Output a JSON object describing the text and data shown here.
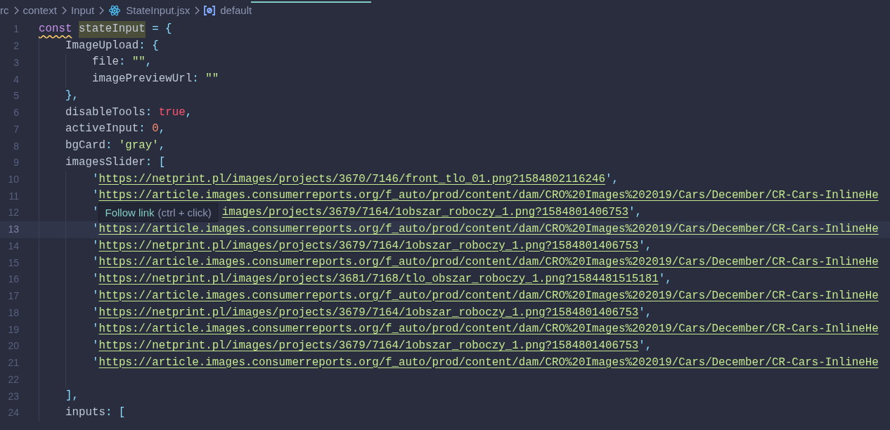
{
  "breadcrumb": [
    {
      "kind": "text",
      "text": "rc"
    },
    {
      "kind": "text",
      "text": "context"
    },
    {
      "kind": "text",
      "text": "Input"
    },
    {
      "kind": "file",
      "text": "StateInput.jsx"
    },
    {
      "kind": "symbol",
      "text": "default"
    }
  ],
  "lines": [
    {
      "number": "1",
      "current": false,
      "tokens": [
        {
          "kind": "keyword",
          "text": "const",
          "warning": true,
          "highlighted": false
        },
        {
          "kind": "variable",
          "text": "stateInput",
          "warning": false,
          "highlighted": true
        },
        {
          "kind": "punct",
          "text": " = {",
          "warning": false,
          "highlighted": false
        }
      ],
      "children": [
        {
          "number": "2",
          "current": false,
          "tokens": [
            {
              "kind": "key",
              "text": "ImageUpload"
            },
            {
              "kind": "punct",
              "text": ": {"
            }
          ],
          "children": [
            {
              "number": "3",
              "current": false,
              "tokens": [
                {
                  "kind": "key",
                  "text": "file"
                },
                {
                  "kind": "punct",
                  "text": ": "
                },
                {
                  "kind": "string",
                  "text": "\"\""
                },
                {
                  "kind": "punct",
                  "text": ","
                }
              ]
            },
            {
              "number": "4",
              "current": false,
              "tokens": [
                {
                  "kind": "key",
                  "text": "imagePreviewUrl"
                },
                {
                  "kind": "punct",
                  "text": ": "
                },
                {
                  "kind": "string",
                  "text": "\"\""
                }
              ]
            }
          ]
        },
        {
          "number": "5",
          "current": false,
          "tokens": [
            {
              "kind": "punct",
              "text": "},"
            }
          ]
        },
        {
          "number": "6",
          "current": false,
          "tokens": [
            {
              "kind": "key",
              "text": "disableTools"
            },
            {
              "kind": "punct",
              "text": ": "
            },
            {
              "kind": "boolean",
              "text": "true"
            },
            {
              "kind": "punct",
              "text": ","
            }
          ]
        },
        {
          "number": "7",
          "current": false,
          "tokens": [
            {
              "kind": "key",
              "text": "activeInput"
            },
            {
              "kind": "punct",
              "text": ": "
            },
            {
              "kind": "number",
              "text": "0"
            },
            {
              "kind": "punct",
              "text": ","
            }
          ]
        },
        {
          "number": "8",
          "current": false,
          "tokens": [
            {
              "kind": "key",
              "text": "bgCard"
            },
            {
              "kind": "punct",
              "text": ": "
            },
            {
              "kind": "string",
              "text": "'gray'"
            },
            {
              "kind": "punct",
              "text": ","
            }
          ]
        },
        {
          "number": "9",
          "current": false,
          "tokens": [
            {
              "kind": "key",
              "text": "imagesSlider"
            },
            {
              "kind": "punct",
              "text": ": ["
            }
          ],
          "children": [
            {
              "number": "10",
              "current": false,
              "tokens": [
                {
                  "kind": "quote",
                  "text": "'"
                },
                {
                  "kind": "link",
                  "text": "https://netprint.pl/images/projects/3670/7146/front_tlo_01.png?1584802116246"
                },
                {
                  "kind": "quote",
                  "text": "'"
                },
                {
                  "kind": "punct",
                  "text": ","
                }
              ]
            },
            {
              "number": "11",
              "current": false,
              "tokens": [
                {
                  "kind": "quote",
                  "text": "'"
                },
                {
                  "kind": "link",
                  "text": "https://article.images.consumerreports.org/f_auto/prod/content/dam/CRO%20Images%202019/Cars/December/CR-Cars-InlineHe"
                }
              ]
            },
            {
              "number": "12",
              "current": false,
              "tokens": [
                {
                  "kind": "quote",
                  "text": "'"
                },
                {
                  "kind": "tooltip",
                  "action": "Follow link",
                  "shortcut": "(ctrl + click)"
                },
                {
                  "kind": "link",
                  "text": "images/projects/3679/7164/1obszar_roboczy_1.png?1584801406753"
                },
                {
                  "kind": "quote",
                  "text": "'"
                },
                {
                  "kind": "punct",
                  "text": ","
                }
              ]
            },
            {
              "number": "13",
              "current": true,
              "tokens": [
                {
                  "kind": "quote",
                  "text": "'"
                },
                {
                  "kind": "link",
                  "text": "https://article.images.consumerreports.org/f_auto/prod/content/dam/CRO%20Images%202019/Cars/December/CR-Cars-InlineHe"
                }
              ]
            },
            {
              "number": "14",
              "current": false,
              "tokens": [
                {
                  "kind": "quote",
                  "text": "'"
                },
                {
                  "kind": "link",
                  "text": "https://netprint.pl/images/projects/3679/7164/1obszar_roboczy_1.png?1584801406753"
                },
                {
                  "kind": "quote",
                  "text": "'"
                },
                {
                  "kind": "punct",
                  "text": ","
                }
              ]
            },
            {
              "number": "15",
              "current": false,
              "tokens": [
                {
                  "kind": "quote",
                  "text": "'"
                },
                {
                  "kind": "link",
                  "text": "https://article.images.consumerreports.org/f_auto/prod/content/dam/CRO%20Images%202019/Cars/December/CR-Cars-InlineHe"
                }
              ]
            },
            {
              "number": "16",
              "current": false,
              "tokens": [
                {
                  "kind": "quote",
                  "text": "'"
                },
                {
                  "kind": "link",
                  "text": "https://netprint.pl/images/projects/3681/7168/tlo_obszar_roboczy_1.png?1584481515181"
                },
                {
                  "kind": "quote",
                  "text": "'"
                },
                {
                  "kind": "punct",
                  "text": ","
                }
              ]
            },
            {
              "number": "17",
              "current": false,
              "tokens": [
                {
                  "kind": "quote",
                  "text": "'"
                },
                {
                  "kind": "link",
                  "text": "https://article.images.consumerreports.org/f_auto/prod/content/dam/CRO%20Images%202019/Cars/December/CR-Cars-InlineHe"
                }
              ]
            },
            {
              "number": "18",
              "current": false,
              "tokens": [
                {
                  "kind": "quote",
                  "text": "'"
                },
                {
                  "kind": "link",
                  "text": "https://netprint.pl/images/projects/3679/7164/1obszar_roboczy_1.png?1584801406753"
                },
                {
                  "kind": "quote",
                  "text": "'"
                },
                {
                  "kind": "punct",
                  "text": ","
                }
              ]
            },
            {
              "number": "19",
              "current": false,
              "tokens": [
                {
                  "kind": "quote",
                  "text": "'"
                },
                {
                  "kind": "link",
                  "text": "https://article.images.consumerreports.org/f_auto/prod/content/dam/CRO%20Images%202019/Cars/December/CR-Cars-InlineHe"
                }
              ]
            },
            {
              "number": "20",
              "current": false,
              "tokens": [
                {
                  "kind": "quote",
                  "text": "'"
                },
                {
                  "kind": "link",
                  "text": "https://netprint.pl/images/projects/3679/7164/1obszar_roboczy_1.png?1584801406753"
                },
                {
                  "kind": "quote",
                  "text": "'"
                },
                {
                  "kind": "punct",
                  "text": ","
                }
              ]
            },
            {
              "number": "21",
              "current": false,
              "tokens": [
                {
                  "kind": "quote",
                  "text": "'"
                },
                {
                  "kind": "link",
                  "text": "https://article.images.consumerreports.org/f_auto/prod/content/dam/CRO%20Images%202019/Cars/December/CR-Cars-InlineHe"
                }
              ]
            },
            {
              "number": "22",
              "current": false
            }
          ]
        },
        {
          "number": "23",
          "current": false,
          "tokens": [
            {
              "kind": "punct",
              "text": "],"
            }
          ]
        },
        {
          "number": "24",
          "current": false,
          "tokens": [
            {
              "kind": "key",
              "text": "inputs"
            },
            {
              "kind": "punct",
              "text": ": ["
            }
          ]
        }
      ]
    }
  ]
}
